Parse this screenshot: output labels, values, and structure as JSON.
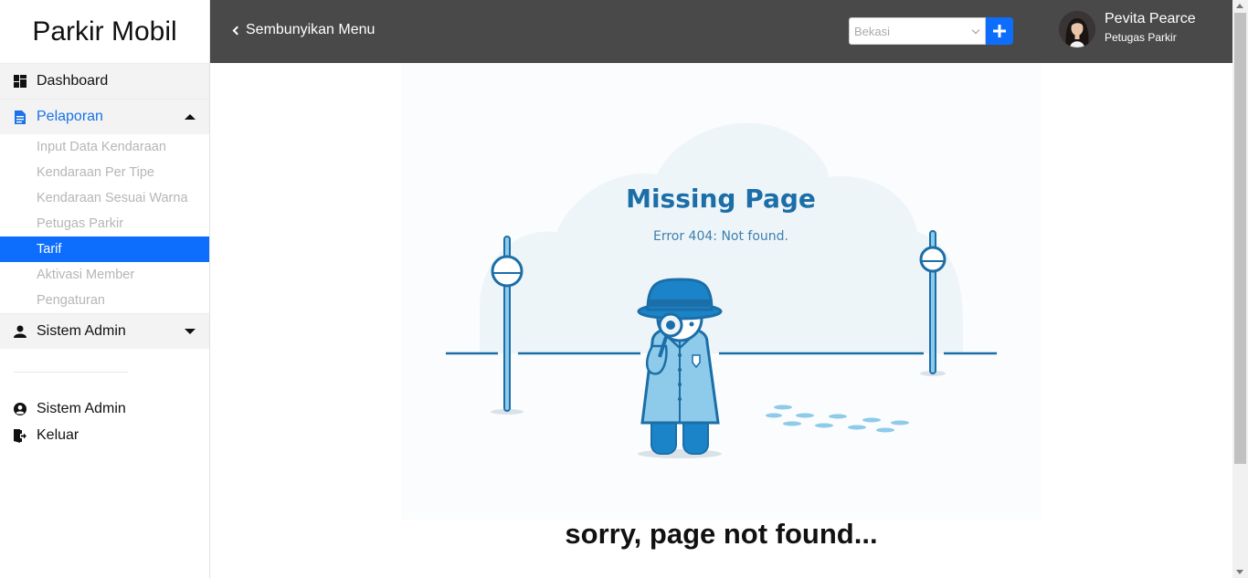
{
  "brand": "Parkir Mobil",
  "sidebar": {
    "dashboard": "Dashboard",
    "pelaporan": "Pelaporan",
    "sub_items": [
      "Input Data Kendaraan",
      "Kendaraan Per Tipe",
      "Kendaraan Sesuai Warna",
      "Petugas Parkir",
      "Tarif",
      "Aktivasi Member",
      "Pengaturan"
    ],
    "sistem_admin": "Sistem Admin",
    "footer": {
      "sistem_admin": "Sistem Admin",
      "keluar": "Keluar"
    }
  },
  "topbar": {
    "toggle_label": "Sembunyikan Menu",
    "location_placeholder": "Bekasi",
    "user_name": "Pevita Pearce",
    "user_role": "Petugas Parkir"
  },
  "main": {
    "illustration_title": "Missing Page",
    "illustration_subtitle": "Error 404: Not found.",
    "message": "sorry, page not found..."
  },
  "colors": {
    "accent": "#0d6efd",
    "topbar": "#494949",
    "illus_blue": "#1b6ea8",
    "illus_light": "#8ecbea"
  }
}
